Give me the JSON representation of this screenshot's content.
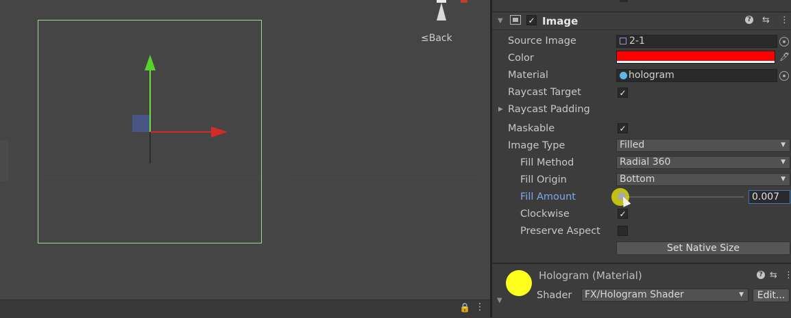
{
  "scene": {
    "back_label": "Back",
    "back_glyph": "≤"
  },
  "image_component": {
    "title": "Image",
    "enabled_glyph": "✓",
    "source_image": {
      "label": "Source Image",
      "value": "2-1"
    },
    "color": {
      "label": "Color",
      "value": "#ff0000"
    },
    "material": {
      "label": "Material",
      "value": "hologram"
    },
    "raycast_target": {
      "label": "Raycast Target",
      "checked": true
    },
    "raycast_padding": {
      "label": "Raycast Padding"
    },
    "maskable": {
      "label": "Maskable",
      "checked": true
    },
    "image_type": {
      "label": "Image Type",
      "value": "Filled"
    },
    "fill_method": {
      "label": "Fill Method",
      "value": "Radial 360"
    },
    "fill_origin": {
      "label": "Fill Origin",
      "value": "Bottom"
    },
    "fill_amount": {
      "label": "Fill Amount",
      "value": "0.007"
    },
    "clockwise": {
      "label": "Clockwise",
      "checked": true
    },
    "preserve_aspect": {
      "label": "Preserve Aspect",
      "checked": false
    },
    "set_native_size": "Set Native Size",
    "check_glyph": "✓"
  },
  "material_section": {
    "title": "Hologram (Material)",
    "shader_label": "Shader",
    "shader_value": "FX/Hologram Shader",
    "edit_label": "Edit...",
    "preview_color": "#ffff1e"
  },
  "icons": {
    "help": "?",
    "presets": "⇆",
    "kebab": "⋮",
    "fold": "▼",
    "expand": "▶",
    "chevron": "▼",
    "lock": "🔒"
  }
}
